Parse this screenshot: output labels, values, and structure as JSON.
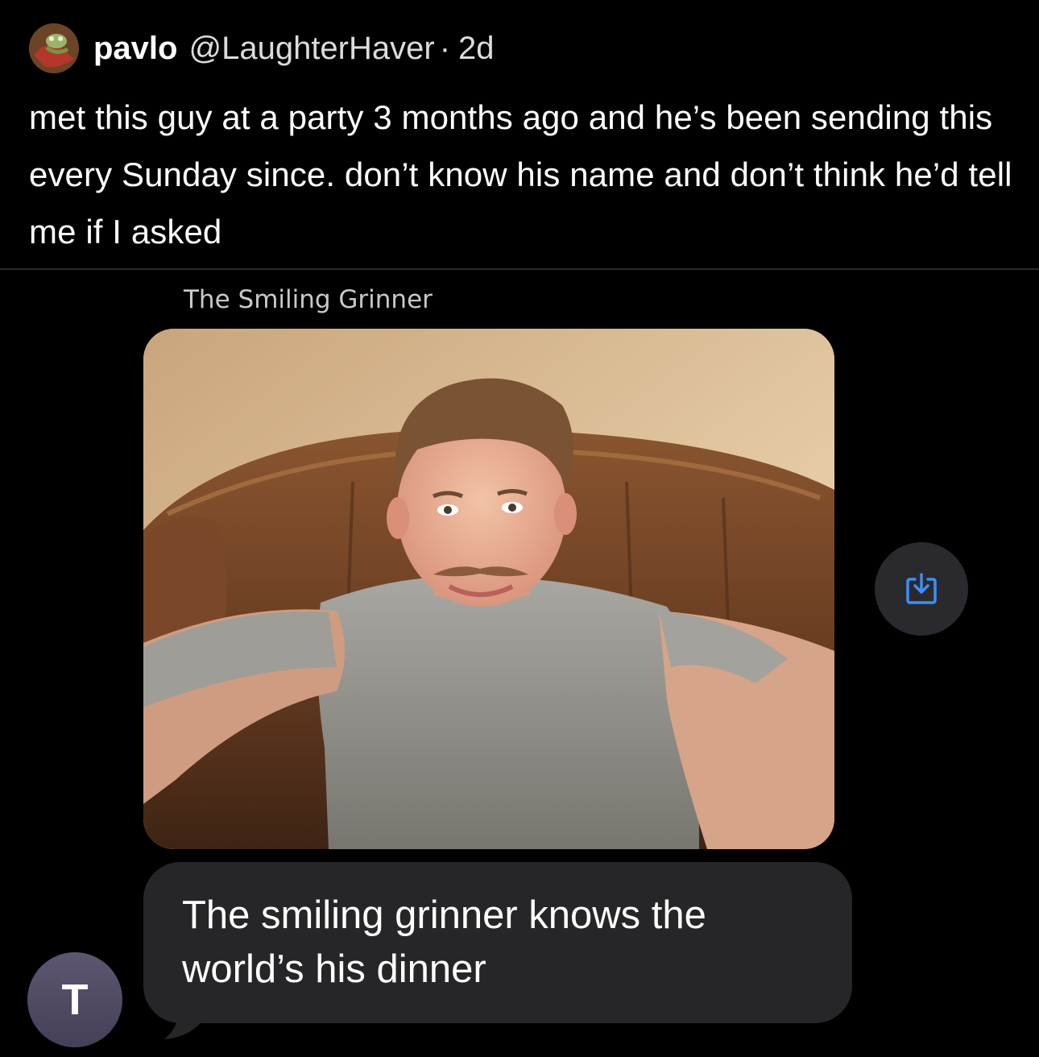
{
  "tweet": {
    "display_name": "pavlo",
    "handle": "@LaughterHaver",
    "separator": "·",
    "timestamp": "2d",
    "text": "met this guy at a party 3 months ago and he’s been sending this every Sunday since. don’t know his name and don’t think he’d tell me if I asked"
  },
  "conversation": {
    "sender_name": "The Smiling Grinner",
    "contact_initial": "T",
    "message": "The smiling grinner knows the world’s his dinner",
    "save_icon": "share-down-arrow-icon"
  },
  "colors": {
    "background": "#000000",
    "bubble": "#262628",
    "save_icon_accent": "#3d8ef5",
    "contact_avatar": "#524a64"
  }
}
